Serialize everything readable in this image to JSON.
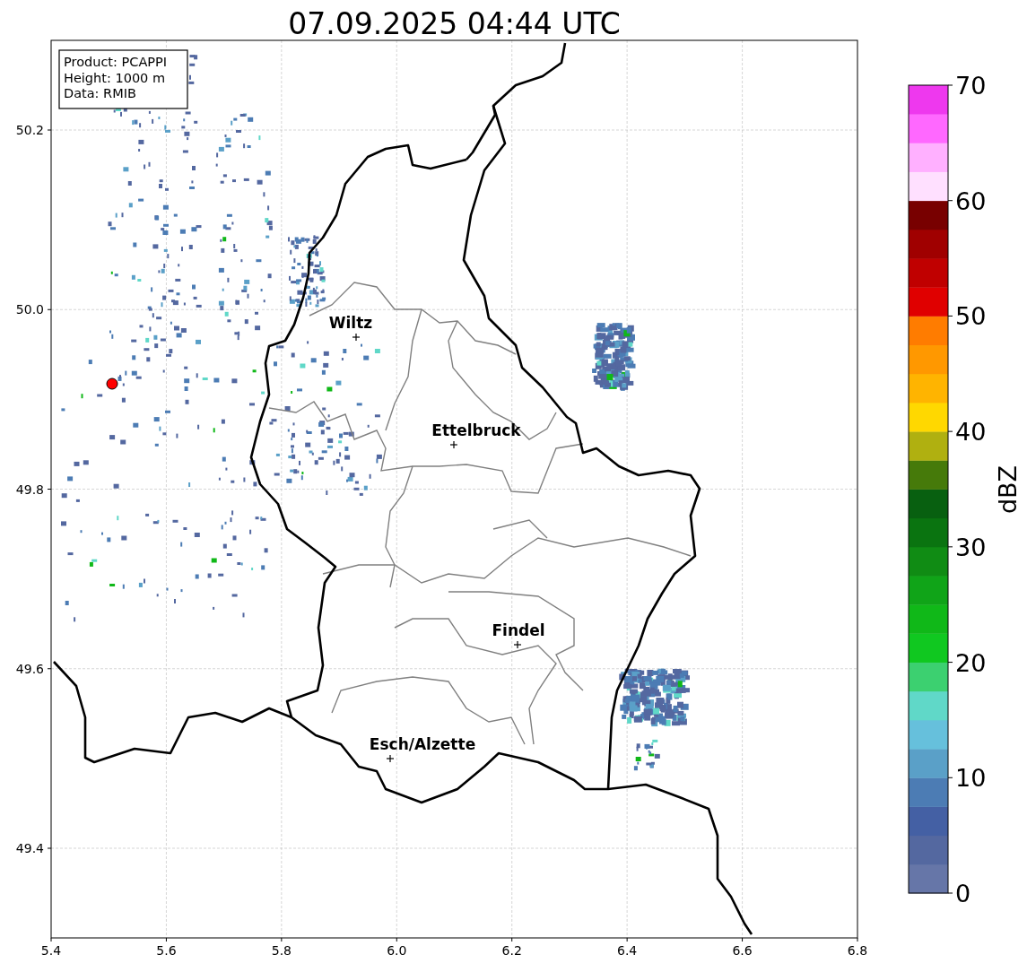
{
  "title": "07.09.2025 04:44 UTC",
  "info_box": [
    "Product: PCAPPI",
    "Height: 1000 m",
    "Data: RMIB"
  ],
  "map": {
    "x_ticks": [
      "5.4",
      "5.6",
      "5.8",
      "6.0",
      "6.2",
      "6.4",
      "6.6",
      "6.8"
    ],
    "y_ticks": [
      "50.2",
      "50.0",
      "49.8",
      "49.6",
      "49.4"
    ],
    "places": [
      {
        "name": "Wiltz"
      },
      {
        "name": "Ettelbruck"
      },
      {
        "name": "Findel"
      },
      {
        "name": "Esch/Alzette"
      }
    ]
  },
  "colorbar": {
    "label": "dBZ",
    "ticks": [
      "70",
      "60",
      "50",
      "40",
      "30",
      "20",
      "10",
      "0"
    ],
    "bins": [
      {
        "color": "#6676a8"
      },
      {
        "color": "#5468a0"
      },
      {
        "color": "#4460a4"
      },
      {
        "color": "#4c7cb4"
      },
      {
        "color": "#5aa0c8"
      },
      {
        "color": "#66c0dc"
      },
      {
        "color": "#60d8c8"
      },
      {
        "color": "#3cd070"
      },
      {
        "color": "#10c820"
      },
      {
        "color": "#10b818"
      },
      {
        "color": "#10a418"
      },
      {
        "color": "#108c14"
      },
      {
        "color": "#0a7410"
      },
      {
        "color": "#086010"
      },
      {
        "color": "#467a0a"
      },
      {
        "color": "#b0b010"
      },
      {
        "color": "#ffd800"
      },
      {
        "color": "#ffb400"
      },
      {
        "color": "#ff9800"
      },
      {
        "color": "#ff7c00"
      },
      {
        "color": "#e00000"
      },
      {
        "color": "#c00000"
      },
      {
        "color": "#a00000"
      },
      {
        "color": "#780000"
      },
      {
        "color": "#ffe0ff"
      },
      {
        "color": "#ffb0ff"
      },
      {
        "color": "#ff68ff"
      },
      {
        "color": "#ee38ee"
      }
    ]
  }
}
